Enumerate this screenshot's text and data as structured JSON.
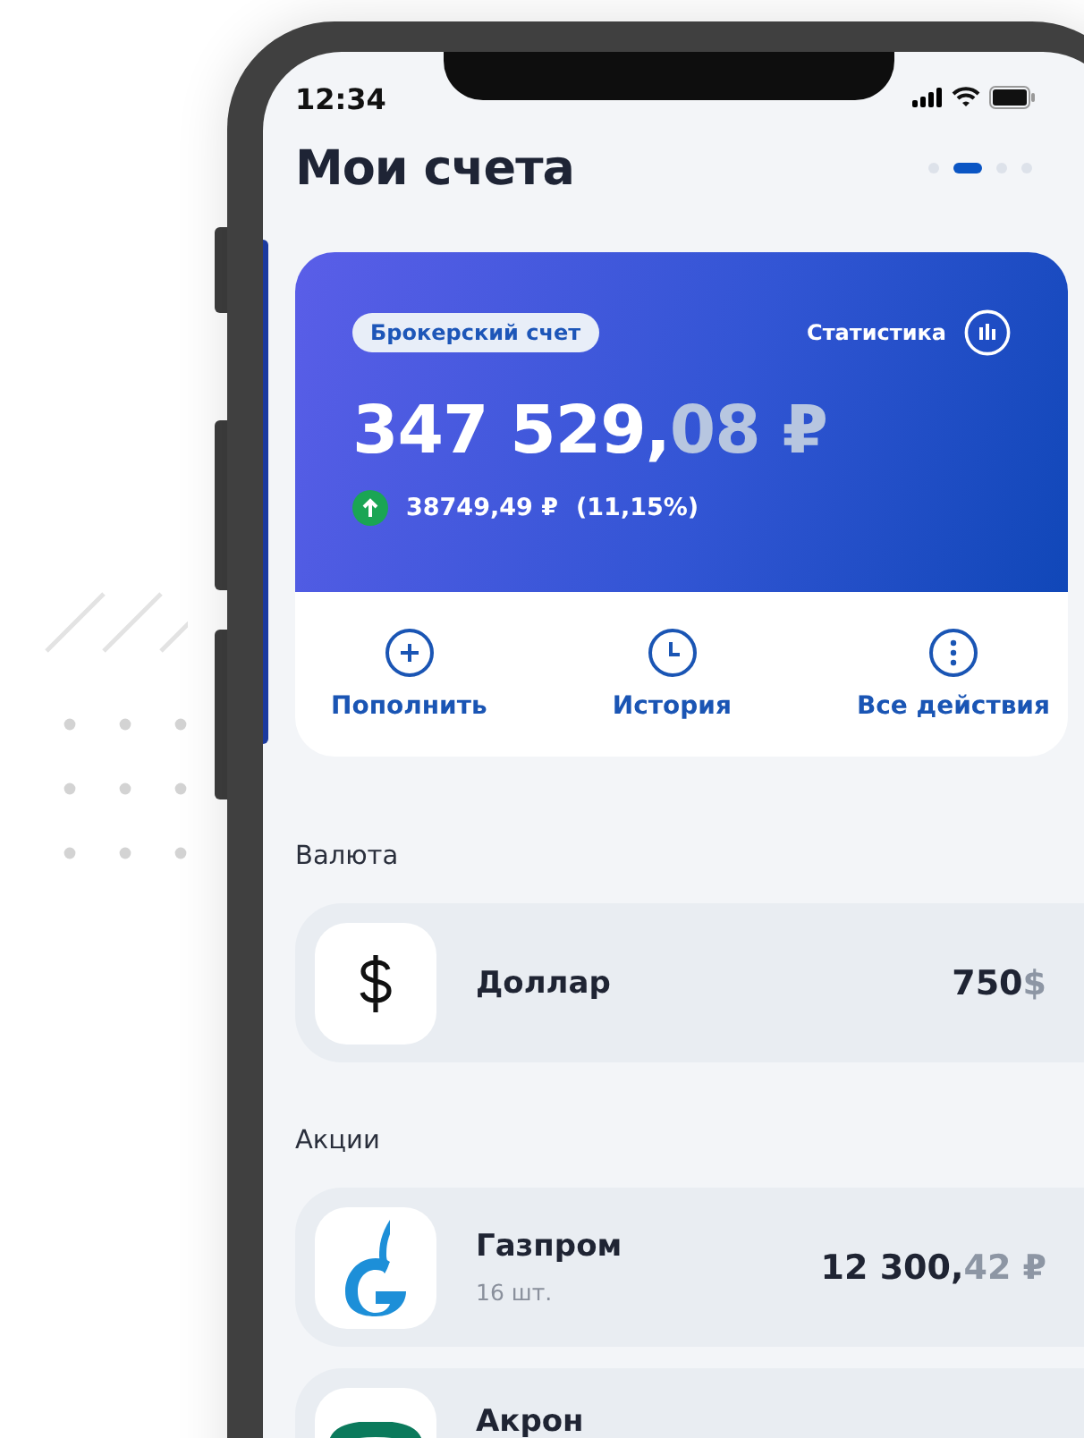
{
  "status_bar": {
    "time": "12:34"
  },
  "title": "Мои счета",
  "page_dots": [
    {
      "selected": false
    },
    {
      "selected": true
    },
    {
      "selected": false
    },
    {
      "selected": false
    }
  ],
  "account_card": {
    "badge": "Брокерский счет",
    "stats_label": "Статистика",
    "balance_main": "347 529,",
    "balance_fraction": "08 ₽",
    "change": "38749,49 ₽",
    "change_percent": "(11,15%)",
    "actions": [
      {
        "kind": "plus",
        "label": "Пополнить"
      },
      {
        "kind": "clock",
        "label": "История"
      },
      {
        "kind": "more",
        "label": "Все действия"
      }
    ]
  },
  "sections": [
    {
      "title": "Валюта",
      "items": [
        {
          "kind": "dollar",
          "name": "Доллар",
          "amount_main": "750",
          "amount_fraction": "$"
        }
      ]
    },
    {
      "title": "Акции",
      "items": [
        {
          "kind": "gazprom",
          "name": "Газпром",
          "subtitle": "16 шт.",
          "amount_main": "12 300,",
          "amount_fraction": "42 ₽"
        },
        {
          "kind": "akron",
          "name": "Акрон"
        }
      ]
    }
  ]
}
